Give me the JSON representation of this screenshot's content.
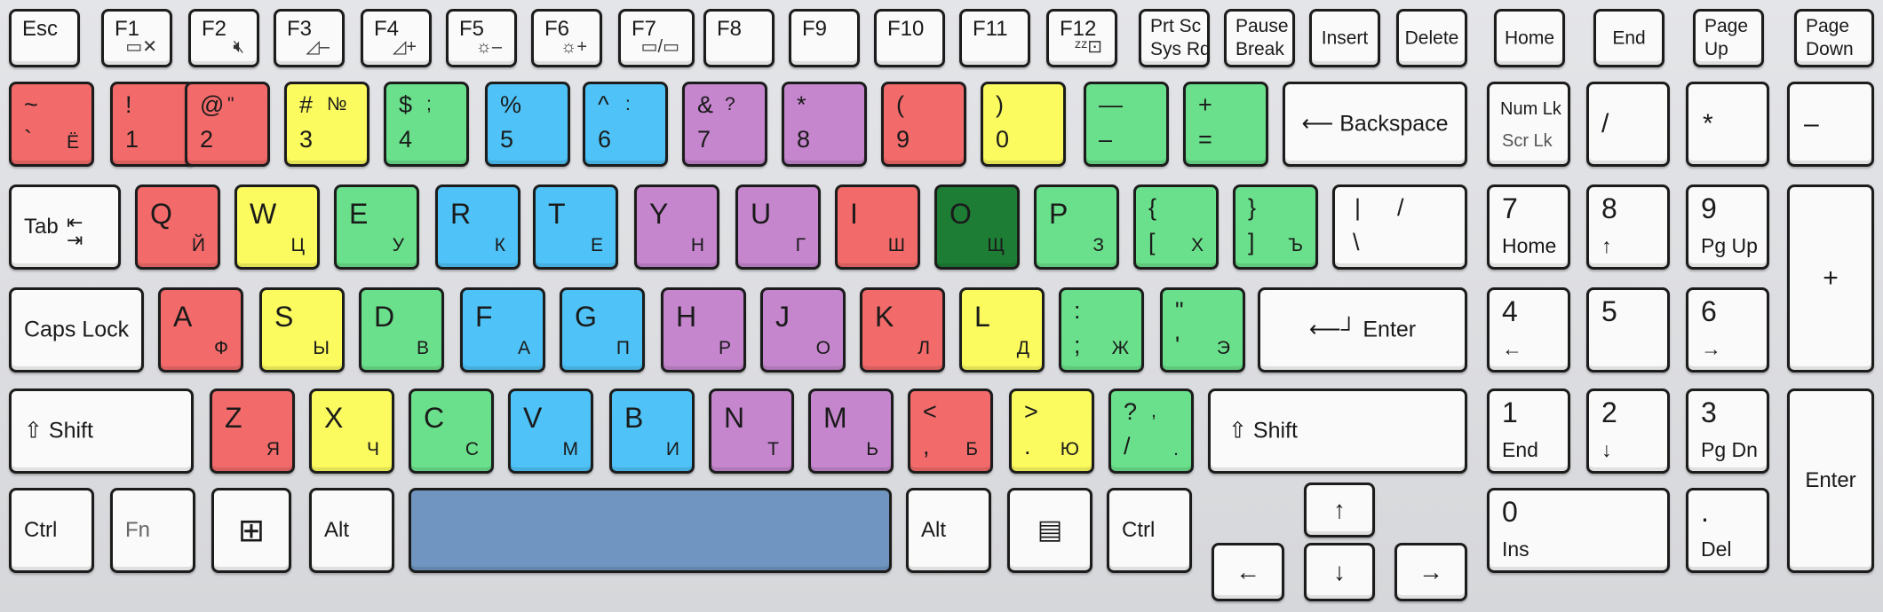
{
  "function_row": {
    "esc": "Esc",
    "f1": "F1",
    "f2": "F2",
    "f3": "F3",
    "f4": "F4",
    "f5": "F5",
    "f6": "F6",
    "f7": "F7",
    "f8": "F8",
    "f9": "F9",
    "f10": "F10",
    "f11": "F11",
    "f12": "F12",
    "prtsc": "Prt Sc",
    "sysrq": "Sys Rq",
    "pause": "Pause",
    "break": "Break",
    "insert": "Insert",
    "delete": "Delete",
    "home": "Home",
    "end": "End",
    "pageup_1": "Page",
    "pageup_2": "Up",
    "pagedown_1": "Page",
    "pagedown_2": "Down"
  },
  "number_row": [
    {
      "top": "~",
      "bottom": "`",
      "ru_top": "",
      "ru_bottom": "Ё",
      "color": "#f26a6a"
    },
    {
      "top": "!",
      "bottom": "1",
      "ru_top": "",
      "ru_bottom": "",
      "color": "#f26a6a"
    },
    {
      "top": "@",
      "bottom": "2",
      "ru_top": "\"",
      "ru_bottom": "",
      "color": "#f26a6a"
    },
    {
      "top": "#",
      "bottom": "3",
      "ru_top": "№",
      "ru_bottom": "",
      "color": "#fbfb60"
    },
    {
      "top": "$",
      "bottom": "4",
      "ru_top": ";",
      "ru_bottom": "",
      "color": "#6be08c"
    },
    {
      "top": "%",
      "bottom": "5",
      "ru_top": "",
      "ru_bottom": "",
      "color": "#4fc3f7"
    },
    {
      "top": "^",
      "bottom": "6",
      "ru_top": ":",
      "ru_bottom": "",
      "color": "#4fc3f7"
    },
    {
      "top": "&",
      "bottom": "7",
      "ru_top": "?",
      "ru_bottom": "",
      "color": "#c586cd"
    },
    {
      "top": "*",
      "bottom": "8",
      "ru_top": "",
      "ru_bottom": "",
      "color": "#c586cd"
    },
    {
      "top": "(",
      "bottom": "9",
      "ru_top": "",
      "ru_bottom": "",
      "color": "#f26a6a"
    },
    {
      "top": ")",
      "bottom": "0",
      "ru_top": "",
      "ru_bottom": "",
      "color": "#fbfb60"
    },
    {
      "top": "—",
      "bottom": "–",
      "ru_top": "",
      "ru_bottom": "",
      "color": "#6be08c"
    },
    {
      "top": "+",
      "bottom": "=",
      "ru_top": "",
      "ru_bottom": "",
      "color": "#6be08c"
    }
  ],
  "backspace": "Backspace",
  "tab": "Tab",
  "qwerty_row": [
    {
      "en": "Q",
      "ru": "Й",
      "color": "#f26a6a"
    },
    {
      "en": "W",
      "ru": "Ц",
      "color": "#fbfb60"
    },
    {
      "en": "E",
      "ru": "У",
      "color": "#6be08c"
    },
    {
      "en": "R",
      "ru": "К",
      "color": "#4fc3f7"
    },
    {
      "en": "T",
      "ru": "Е",
      "color": "#4fc3f7"
    },
    {
      "en": "Y",
      "ru": "Н",
      "color": "#c586cd"
    },
    {
      "en": "U",
      "ru": "Г",
      "color": "#c586cd"
    },
    {
      "en": "I",
      "ru": "Ш",
      "color": "#f26a6a"
    },
    {
      "en": "O",
      "ru": "Щ",
      "color": "#1e7d34"
    },
    {
      "en": "P",
      "ru": "З",
      "color": "#6be08c"
    },
    {
      "en_top": "{",
      "en_bottom": "[",
      "ru": "Х",
      "color": "#6be08c"
    },
    {
      "en_top": "}",
      "en_bottom": "]",
      "ru": "Ъ",
      "color": "#6be08c"
    }
  ],
  "pipe_key": {
    "top_left": "|",
    "top_right": "/",
    "bottom": "\\"
  },
  "caps_lock": "Caps Lock",
  "home_row": [
    {
      "en": "A",
      "ru": "Ф",
      "color": "#f26a6a"
    },
    {
      "en": "S",
      "ru": "Ы",
      "color": "#fbfb60"
    },
    {
      "en": "D",
      "ru": "В",
      "color": "#6be08c"
    },
    {
      "en": "F",
      "ru": "А",
      "color": "#4fc3f7"
    },
    {
      "en": "G",
      "ru": "П",
      "color": "#4fc3f7"
    },
    {
      "en": "H",
      "ru": "Р",
      "color": "#c586cd"
    },
    {
      "en": "J",
      "ru": "О",
      "color": "#c586cd"
    },
    {
      "en": "K",
      "ru": "Л",
      "color": "#f26a6a"
    },
    {
      "en": "L",
      "ru": "Д",
      "color": "#fbfb60"
    },
    {
      "en_top": ":",
      "en_bottom": ";",
      "ru": "Ж",
      "color": "#6be08c"
    },
    {
      "en_top": "\"",
      "en_bottom": "'",
      "ru": "Э",
      "color": "#6be08c"
    }
  ],
  "enter": "Enter",
  "shift": "Shift",
  "bottom_letter_row": [
    {
      "en": "Z",
      "ru": "Я",
      "color": "#f26a6a"
    },
    {
      "en": "X",
      "ru": "Ч",
      "color": "#fbfb60"
    },
    {
      "en": "C",
      "ru": "С",
      "color": "#6be08c"
    },
    {
      "en": "V",
      "ru": "М",
      "color": "#4fc3f7"
    },
    {
      "en": "B",
      "ru": "И",
      "color": "#4fc3f7"
    },
    {
      "en": "N",
      "ru": "Т",
      "color": "#c586cd"
    },
    {
      "en": "M",
      "ru": "Ь",
      "color": "#c586cd"
    },
    {
      "en_top": "<",
      "en_bottom": ",",
      "ru": "Б",
      "color": "#f26a6a"
    },
    {
      "en_top": ">",
      "en_bottom": ".",
      "ru": "Ю",
      "color": "#fbfb60"
    },
    {
      "en_top": "?",
      "en_bottom": "/",
      "ru_top": ",",
      "ru": ".",
      "color": "#6be08c"
    }
  ],
  "modifiers": {
    "ctrl": "Ctrl",
    "fn": "Fn",
    "alt": "Alt",
    "alt_r": "Alt",
    "ctrl_r": "Ctrl"
  },
  "arrows": {
    "up": "↑",
    "down": "↓",
    "left": "←",
    "right": "→"
  },
  "numpad": {
    "numlk": "Num Lk",
    "scrlk": "Scr Lk",
    "slash": "/",
    "star": "*",
    "minus": "–",
    "plus": "+",
    "n7": "7",
    "n7_sub": "Home",
    "n8": "8",
    "n8_sub": "↑",
    "n9": "9",
    "n9_sub": "Pg Up",
    "n4": "4",
    "n4_sub": "←",
    "n5": "5",
    "n6": "6",
    "n6_sub": "→",
    "n1": "1",
    "n1_sub": "End",
    "n2": "2",
    "n2_sub": "↓",
    "n3": "3",
    "n3_sub": "Pg Dn",
    "n0": "0",
    "n0_sub": "Ins",
    "dot": ".",
    "dot_sub": "Del",
    "enter": "Enter"
  },
  "colors": {
    "red": "#f26a6a",
    "yellow": "#fbfb60",
    "green": "#6be08c",
    "blue": "#4fc3f7",
    "purple": "#c586cd",
    "dark_green": "#1e7d34",
    "space": "#7095c0",
    "key": "#fafafa"
  }
}
